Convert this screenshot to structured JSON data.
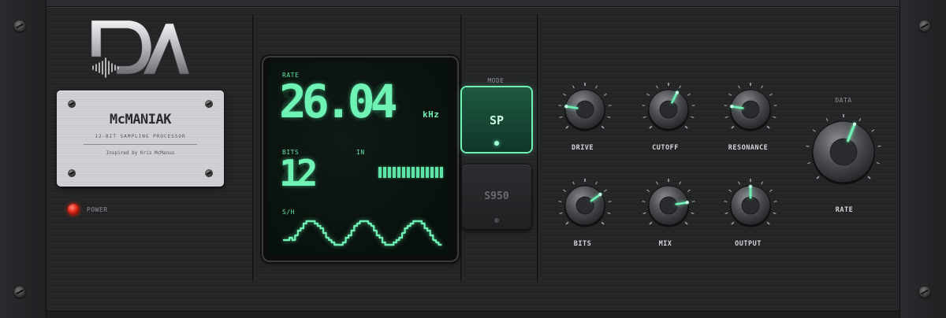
{
  "brand": {
    "logo_icon": "da-waveform-logo-icon",
    "badge": {
      "name": "McMANIAK",
      "subtitle": "12-BIT SAMPLING PROCESSOR",
      "credit": "Inspired by Kris McManus"
    }
  },
  "power": {
    "label": "POWER",
    "state": "on",
    "led_color": "#e02a1a"
  },
  "display": {
    "rate_label": "RATE",
    "rate_value": "26.04",
    "rate_unit": "kHz",
    "bits_label": "BITS",
    "bits_value": "12",
    "in_label": "IN",
    "in_level_segments": 14,
    "sh_label": "S/H",
    "accent_color": "#6ef3b4"
  },
  "mode": {
    "label": "MODE",
    "options": [
      {
        "label": "SP",
        "active": true
      },
      {
        "label": "S950",
        "active": false
      }
    ]
  },
  "knobs": [
    {
      "id": "drive",
      "label": "DRIVE",
      "value": 0.2
    },
    {
      "id": "cutoff",
      "label": "CUTOFF",
      "value": 0.6
    },
    {
      "id": "resonance",
      "label": "RESONANCE",
      "value": 0.2
    },
    {
      "id": "bits",
      "label": "BITS",
      "value": 0.7
    },
    {
      "id": "mix",
      "label": "MIX",
      "value": 0.8
    },
    {
      "id": "output",
      "label": "OUTPUT",
      "value": 0.5
    }
  ],
  "data_knob": {
    "section_label": "DATA",
    "label": "RATE",
    "value": 0.58
  }
}
